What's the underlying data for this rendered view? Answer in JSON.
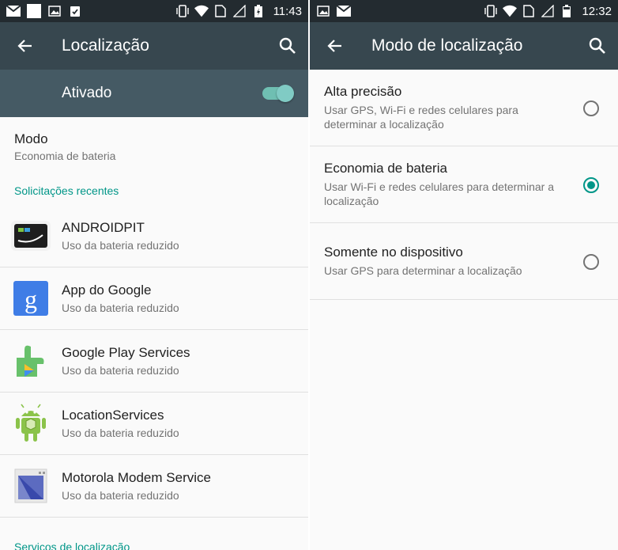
{
  "left": {
    "status_time": "11:43",
    "title": "Localização",
    "master_switch": {
      "label": "Ativado",
      "on": true
    },
    "mode": {
      "title": "Modo",
      "value": "Economia de bateria"
    },
    "recent_section": "Solicitações recentes",
    "apps": [
      {
        "name": "ANDROIDPIT",
        "status": "Uso da bateria reduzido",
        "icon": "androidpit-icon"
      },
      {
        "name": "App do Google",
        "status": "Uso da bateria reduzido",
        "icon": "google-icon"
      },
      {
        "name": "Google Play Services",
        "status": "Uso da bateria reduzido",
        "icon": "play-services-icon"
      },
      {
        "name": "LocationServices",
        "status": "Uso da bateria reduzido",
        "icon": "android-icon"
      },
      {
        "name": "Motorola Modem Service",
        "status": "Uso da bateria reduzido",
        "icon": "motorola-icon"
      }
    ],
    "services_section": "Serviços de localização"
  },
  "right": {
    "status_time": "12:32",
    "title": "Modo de localização",
    "options": [
      {
        "title": "Alta precisão",
        "desc": "Usar GPS, Wi-Fi e redes celulares para determinar a localização",
        "selected": false
      },
      {
        "title": "Economia de bateria",
        "desc": "Usar Wi-Fi e redes celulares para determinar a localização",
        "selected": true
      },
      {
        "title": "Somente no dispositivo",
        "desc": "Usar GPS para determinar a localização",
        "selected": false
      }
    ]
  },
  "colors": {
    "toolbar": "#37474f",
    "switchbar": "#455a64",
    "accent": "#009688",
    "statusbar": "#232b30"
  }
}
